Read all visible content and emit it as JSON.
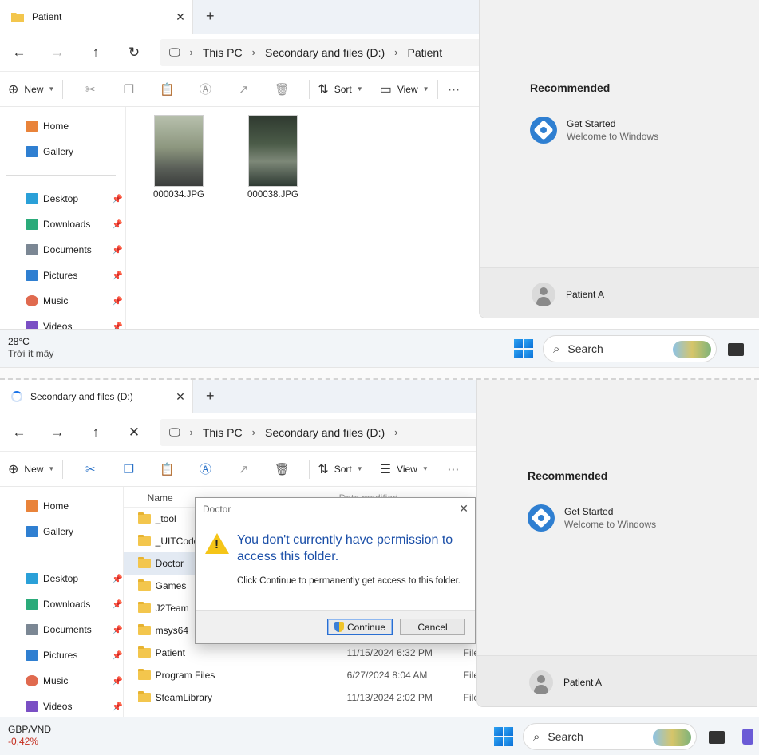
{
  "top": {
    "tab_title": "Patient",
    "breadcrumb": [
      "This PC",
      "Secondary and files (D:)",
      "Patient"
    ],
    "cmd": {
      "new": "New",
      "sort": "Sort",
      "view": "View"
    },
    "sidebar": {
      "home": "Home",
      "gallery": "Gallery",
      "pinned": [
        "Desktop",
        "Downloads",
        "Documents",
        "Pictures",
        "Music",
        "Videos"
      ]
    },
    "files": [
      {
        "name": "000034.JPG"
      },
      {
        "name": "000038.JPG"
      }
    ],
    "start": {
      "recommended": "Recommended",
      "app_name": "Get Started",
      "app_desc": "Welcome to Windows",
      "user": "Patient A"
    },
    "taskbar": {
      "weather_temp": "28°C",
      "weather_desc": "Trời ít mây",
      "search": "Search"
    }
  },
  "bottom": {
    "tab_title": "Secondary and files (D:)",
    "breadcrumb": [
      "This PC",
      "Secondary and files (D:)"
    ],
    "cmd": {
      "new": "New",
      "sort": "Sort",
      "view": "View"
    },
    "sidebar": {
      "home": "Home",
      "gallery": "Gallery",
      "pinned": [
        "Desktop",
        "Downloads",
        "Documents",
        "Pictures",
        "Music",
        "Videos"
      ]
    },
    "list": {
      "col_name": "Name",
      "col_date": "Date modified",
      "rows": [
        {
          "name": "_tool",
          "date": "",
          "type": ""
        },
        {
          "name": "_UITCode",
          "date": "",
          "type": ""
        },
        {
          "name": "Doctor",
          "date": "",
          "type": ""
        },
        {
          "name": "Games",
          "date": "",
          "type": ""
        },
        {
          "name": "J2Team",
          "date": "",
          "type": ""
        },
        {
          "name": "msys64",
          "date": "",
          "type": ""
        },
        {
          "name": "Patient",
          "date": "11/15/2024 6:32 PM",
          "type": "File"
        },
        {
          "name": "Program Files",
          "date": "6/27/2024 8:04 AM",
          "type": "File"
        },
        {
          "name": "SteamLibrary",
          "date": "11/13/2024 2:02 PM",
          "type": "File"
        }
      ]
    },
    "dialog": {
      "title": "Doctor",
      "main": "You don't currently have permission to access this folder.",
      "sub": "Click Continue to permanently get access to this folder.",
      "continue": "Continue",
      "cancel": "Cancel"
    },
    "start": {
      "recommended": "Recommended",
      "app_name": "Get Started",
      "app_desc": "Welcome to Windows",
      "user": "Patient A"
    },
    "taskbar": {
      "ticker": "GBP/VND",
      "change": "-0,42%",
      "search": "Search"
    }
  }
}
